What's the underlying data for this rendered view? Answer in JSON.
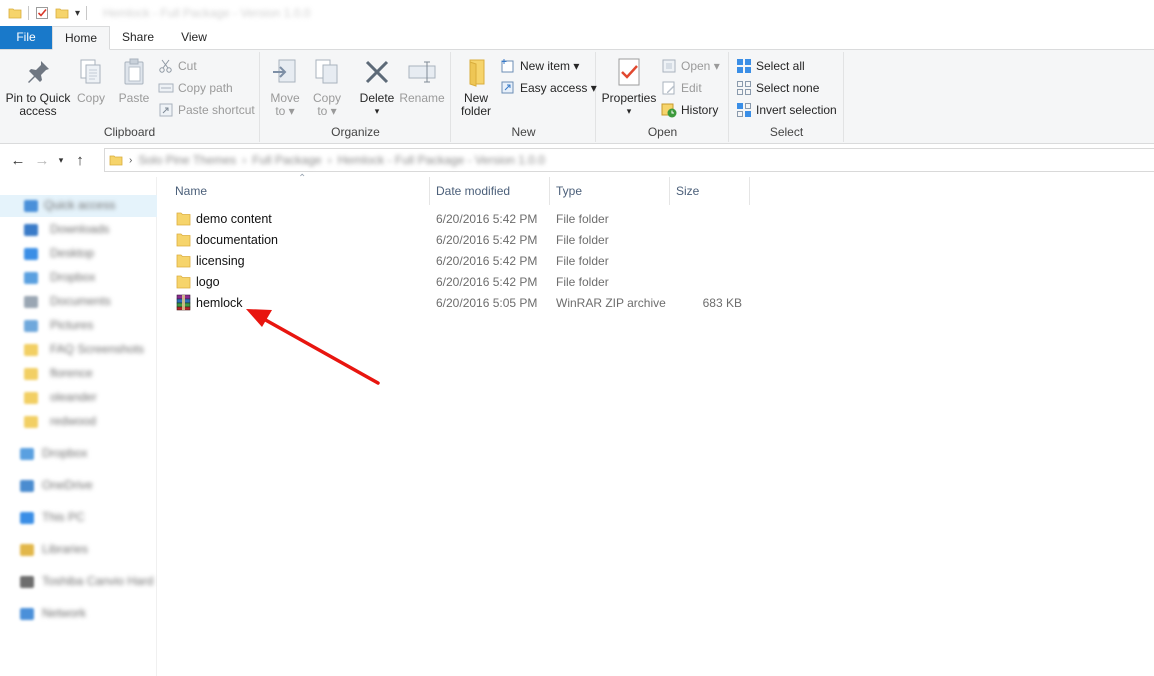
{
  "window": {
    "title": "Hemlock - Full Package - Version 1.0.0"
  },
  "tabs": [
    {
      "label": "File"
    },
    {
      "label": "Home"
    },
    {
      "label": "Share"
    },
    {
      "label": "View"
    }
  ],
  "ribbon": {
    "clipboard": {
      "label": "Clipboard",
      "pin_label_1": "Pin to Quick",
      "pin_label_2": "access",
      "copy_label": "Copy",
      "paste_label": "Paste",
      "cut_label": "Cut",
      "copy_path_label": "Copy path",
      "paste_shortcut_label": "Paste shortcut"
    },
    "organize": {
      "label": "Organize",
      "move_label_1": "Move",
      "move_label_2": "to ▾",
      "copy_label_1": "Copy",
      "copy_label_2": "to ▾",
      "delete_label_1": "Delete",
      "delete_label_2": "▾",
      "rename_label": "Rename"
    },
    "new": {
      "label": "New",
      "new_folder_label_1": "New",
      "new_folder_label_2": "folder",
      "new_item_label": "New item ▾",
      "easy_access_label": "Easy access ▾"
    },
    "open": {
      "label": "Open",
      "properties_label_1": "Properties",
      "properties_label_2": "▾",
      "open_label": "Open ▾",
      "edit_label": "Edit",
      "history_label": "History"
    },
    "select": {
      "label": "Select",
      "select_all_label": "Select all",
      "select_none_label": "Select none",
      "invert_label": "Invert selection"
    }
  },
  "address": {
    "path_1": "Solo Pine Themes",
    "path_2": "Full Package",
    "path_3": "Hemlock - Full Package - Version 1.0.0"
  },
  "navpane": {
    "items": [
      {
        "label": "Quick access"
      },
      {
        "label": "Downloads"
      },
      {
        "label": "Desktop"
      },
      {
        "label": "Dropbox"
      },
      {
        "label": "Documents"
      },
      {
        "label": "Pictures"
      },
      {
        "label": "FAQ Screenshots"
      },
      {
        "label": "florence"
      },
      {
        "label": "oleander"
      },
      {
        "label": "redwood"
      },
      {
        "label": "Dropbox"
      },
      {
        "label": "OneDrive"
      },
      {
        "label": "This PC"
      },
      {
        "label": "Libraries"
      },
      {
        "label": "Toshiba Canvio Hard"
      },
      {
        "label": "Network"
      }
    ]
  },
  "filelist": {
    "columns": {
      "name": "Name",
      "date": "Date modified",
      "type": "Type",
      "size": "Size"
    },
    "rows": [
      {
        "name": "demo content",
        "date": "6/20/2016 5:42 PM",
        "type": "File folder",
        "size": ""
      },
      {
        "name": "documentation",
        "date": "6/20/2016 5:42 PM",
        "type": "File folder",
        "size": ""
      },
      {
        "name": "licensing",
        "date": "6/20/2016 5:42 PM",
        "type": "File folder",
        "size": ""
      },
      {
        "name": "logo",
        "date": "6/20/2016 5:42 PM",
        "type": "File folder",
        "size": ""
      },
      {
        "name": "hemlock",
        "date": "6/20/2016 5:05 PM",
        "type": "WinRAR ZIP archive",
        "size": "683 KB"
      }
    ]
  },
  "colors": {
    "file_tab": "#1979ca",
    "folder": "#f6d46b",
    "annotation_arrow": "#e8150f",
    "selection": "#e5f3fb"
  }
}
